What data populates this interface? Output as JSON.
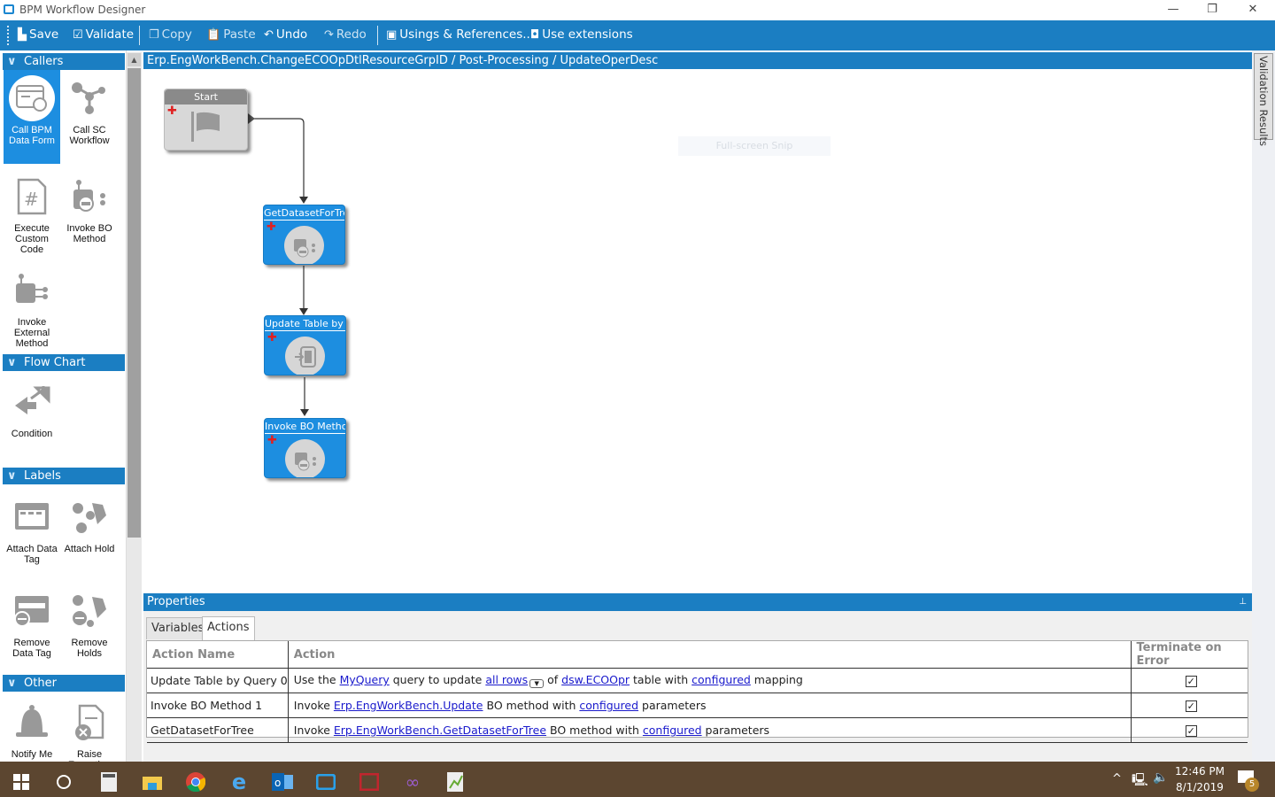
{
  "window": {
    "title": "BPM Workflow Designer",
    "minimize": "—",
    "restore": "❐",
    "close": "✕"
  },
  "toolbar": {
    "items": [
      {
        "label": "Save",
        "icon": "save-icon",
        "glyph": "▙"
      },
      {
        "label": "Validate",
        "icon": "validate-check-icon",
        "glyph": "☑"
      },
      {
        "label": "Copy",
        "icon": "copy-icon",
        "glyph": "❐"
      },
      {
        "label": "Paste",
        "icon": "paste-icon",
        "glyph": "📋"
      },
      {
        "label": "Undo",
        "icon": "undo-icon",
        "glyph": "↶"
      },
      {
        "label": "Redo",
        "icon": "redo-icon",
        "glyph": "↷"
      },
      {
        "label": "Usings & References...",
        "icon": "references-icon",
        "glyph": "▣"
      },
      {
        "label": "Use extensions",
        "icon": "extensions-icon",
        "glyph": "◘"
      }
    ]
  },
  "sidebar": {
    "callers": {
      "label": "Callers",
      "items": [
        "Call BPM Data Form",
        "Call SC Workflow",
        "Execute Custom Code",
        "Invoke BO Method",
        "Invoke External Method"
      ]
    },
    "flowchart": {
      "label": "Flow Chart",
      "items": [
        "Condition"
      ]
    },
    "labels": {
      "label": "Labels",
      "items": [
        "Attach Data Tag",
        "Attach Hold",
        "Remove Data Tag",
        "Remove Holds"
      ]
    },
    "other": {
      "label": "Other",
      "items": [
        "Notify Me",
        "Raise Exception"
      ]
    }
  },
  "breadcrumb": "Erp.EngWorkBench.ChangeECOOpDtlResourceGrpID / Post-Processing / UpdateOperDesc",
  "canvas": {
    "overlay_text": "Full-screen Snip",
    "nodes": [
      {
        "title": "Start",
        "type": "start"
      },
      {
        "title": "GetDatasetForTree",
        "type": "invoke-bo"
      },
      {
        "title": "Update Table by Q",
        "type": "update-table"
      },
      {
        "title": "Invoke BO Method",
        "type": "invoke-bo"
      }
    ]
  },
  "validation_tab": "Validation Results",
  "properties": {
    "title": "Properties",
    "pin": "⊥",
    "tabs": [
      "Variables",
      "Actions"
    ],
    "active_tab": "Actions",
    "columns": [
      "Action Name",
      "Action",
      "Terminate on Error"
    ],
    "rows": [
      {
        "name": "Update Table by Query 0",
        "parts": [
          "Use the ",
          {
            "link": "MyQuery"
          },
          " query to update ",
          {
            "link": "all rows",
            "dropdown": true
          },
          " of ",
          {
            "link": "dsw.ECOOpr"
          },
          " table with ",
          {
            "link": "configured"
          },
          " mapping"
        ],
        "terminate": true
      },
      {
        "name": "Invoke BO Method 1",
        "parts": [
          "Invoke ",
          {
            "link": "Erp.EngWorkBench.Update"
          },
          " BO method with ",
          {
            "link": "configured"
          },
          " parameters"
        ],
        "terminate": true
      },
      {
        "name": "GetDatasetForTree",
        "parts": [
          "Invoke ",
          {
            "link": "Erp.EngWorkBench.GetDatasetForTree"
          },
          " BO method with ",
          {
            "link": "configured"
          },
          " parameters"
        ],
        "terminate": true
      }
    ]
  },
  "taskbar": {
    "time": "12:46 PM",
    "date": "8/1/2019",
    "notifications": "5"
  },
  "colors": {
    "accent": "#1b7ec2",
    "selected": "#1d8ee0",
    "taskbar": "#5c4630"
  }
}
